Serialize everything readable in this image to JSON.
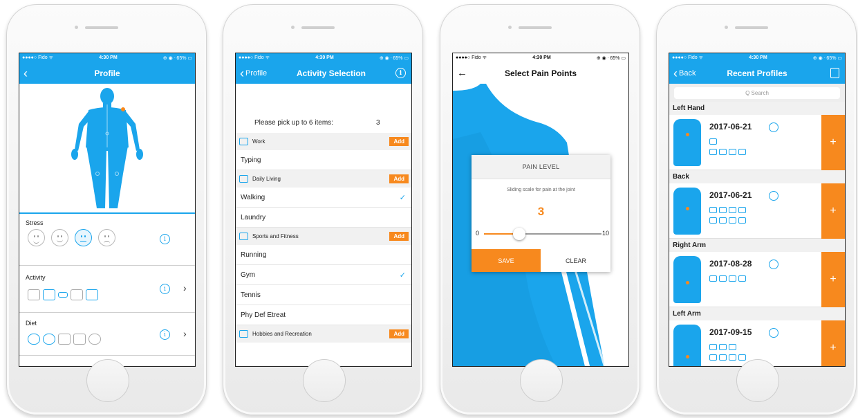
{
  "screen1": {
    "status": {
      "carrier": "●●●●○ Fido ᯤ",
      "time": "4:30 PM",
      "right": "⊕ ◉ ᐧ 65% ▭"
    },
    "nav": {
      "title": "Profile",
      "back_icon": "chevron-left-icon"
    },
    "stress_label": "Stress",
    "activity_label": "Activity",
    "diet_label": "Diet",
    "info_glyph": "i",
    "arrow_glyph": "›"
  },
  "screen2": {
    "status": {
      "carrier": "●●●●○ Fido ᯤ",
      "time": "4:30 PM",
      "right": "⊕ ◉ ᐧ 65% ▭"
    },
    "nav": {
      "back_label": "Profile",
      "title": "Activity Selection"
    },
    "prompt": "Please pick up to 6 items:",
    "count": "3",
    "add_label": "Add",
    "categories": [
      {
        "label": "Work",
        "items": [
          {
            "label": "Typing",
            "checked": false
          }
        ]
      },
      {
        "label": "Daily Living",
        "items": [
          {
            "label": "Walking",
            "checked": true
          },
          {
            "label": "Laundry",
            "checked": false
          }
        ]
      },
      {
        "label": "Sports and Fitness",
        "items": [
          {
            "label": "Running",
            "checked": false
          },
          {
            "label": "Gym",
            "checked": true
          },
          {
            "label": "Tennis",
            "checked": false
          },
          {
            "label": "Phy Def Etreat",
            "checked": false
          }
        ]
      },
      {
        "label": "Hobbies and Recreation",
        "items": []
      }
    ],
    "check_glyph": "✓"
  },
  "screen3": {
    "status": {
      "carrier": "●●●●○ Fido ᯤ",
      "time": "4:30 PM",
      "right": "⊕ ◉ ᐧ 65% ▭"
    },
    "nav": {
      "title": "Select Pain Points",
      "back_glyph": "←"
    },
    "dialog": {
      "title": "PAIN LEVEL",
      "subtitle": "Sliding scale for pain at the joint",
      "value": "3",
      "min": "0",
      "max": "10",
      "level": 0.3,
      "save_label": "SAVE",
      "clear_label": "CLEAR"
    }
  },
  "screen4": {
    "status": {
      "carrier": "●●●●○ Fido ᯤ",
      "time": "4:30 PM",
      "right": "⊕ ◉ ᐧ 65% ▭"
    },
    "nav": {
      "back_label": "Back",
      "title": "Recent Profiles"
    },
    "search_placeholder": "Q Search",
    "plus_glyph": "+",
    "profiles": [
      {
        "group": "Left Hand",
        "date": "2017-06-21"
      },
      {
        "group": "Back",
        "date": "2017-06-21"
      },
      {
        "group": "Right Arm",
        "date": "2017-08-28"
      },
      {
        "group": "Left Arm",
        "date": "2017-09-15"
      }
    ]
  },
  "colors": {
    "blue": "#1aa5ec",
    "orange": "#f7891e"
  }
}
